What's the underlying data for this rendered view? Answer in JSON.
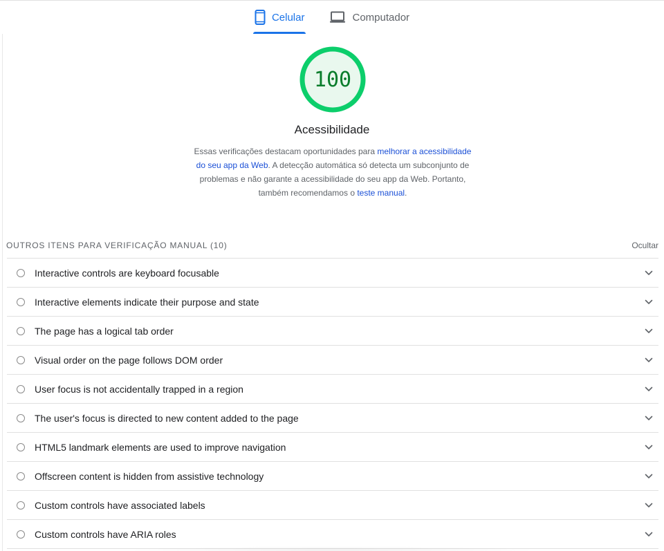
{
  "tabs": [
    {
      "label": "Celular",
      "icon": "phone-icon",
      "active": true
    },
    {
      "label": "Computador",
      "icon": "laptop-icon",
      "active": false
    }
  ],
  "gauge": {
    "score": "100",
    "score_value": 100,
    "title": "Acessibilidade",
    "color": "#0cce6b",
    "fill": "#e9f8ee",
    "text_color": "#0a7d2c"
  },
  "description": {
    "part1": "Essas verificações destacam oportunidades para ",
    "link1": "melhorar a acessibilidade do seu app da Web",
    "part2": ". A detecção automática só detecta um subconjunto de problemas e não garante a acessibilidade do seu app da Web. Portanto, também recomendamos o ",
    "link2": "teste manual",
    "part3": "."
  },
  "section": {
    "title": "Outros itens para verificação manual",
    "count": "(10)",
    "toggle_label": "Ocultar"
  },
  "audits": [
    {
      "label": "Interactive controls are keyboard focusable"
    },
    {
      "label": "Interactive elements indicate their purpose and state"
    },
    {
      "label": "The page has a logical tab order"
    },
    {
      "label": "Visual order on the page follows DOM order"
    },
    {
      "label": "User focus is not accidentally trapped in a region"
    },
    {
      "label": "The user's focus is directed to new content added to the page"
    },
    {
      "label": "HTML5 landmark elements are used to improve navigation"
    },
    {
      "label": "Offscreen content is hidden from assistive technology"
    },
    {
      "label": "Custom controls have associated labels"
    },
    {
      "label": "Custom controls have ARIA roles"
    }
  ],
  "colors": {
    "accent": "#1a73e8",
    "link": "#1a4fd6"
  }
}
